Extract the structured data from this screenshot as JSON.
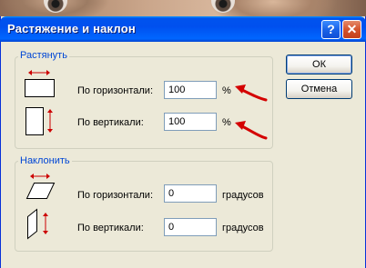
{
  "window": {
    "title": "Растяжение и наклон",
    "help_label": "?",
    "close_label": "✕"
  },
  "stretch": {
    "legend": "Растянуть",
    "horizontal_label": "По горизонтали:",
    "horizontal_value": "100",
    "horizontal_unit": "%",
    "vertical_label": "По вертикали:",
    "vertical_value": "100",
    "vertical_unit": "%"
  },
  "skew": {
    "legend": "Наклонить",
    "horizontal_label": "По горизонтали:",
    "horizontal_value": "0",
    "horizontal_unit": "градусов",
    "vertical_label": "По вертикали:",
    "vertical_value": "0",
    "vertical_unit": "градусов"
  },
  "buttons": {
    "ok_label": "ОК",
    "cancel_label": "Отмена"
  },
  "colors": {
    "title_bar": "#0055ea",
    "group_legend": "#0046d5",
    "annotation_arrow": "#d40000",
    "icon_arrow": "#cc0000"
  },
  "icons": [
    "stretch-horizontal-icon",
    "stretch-vertical-icon",
    "skew-horizontal-icon",
    "skew-vertical-icon",
    "annotation-arrow-icon"
  ]
}
